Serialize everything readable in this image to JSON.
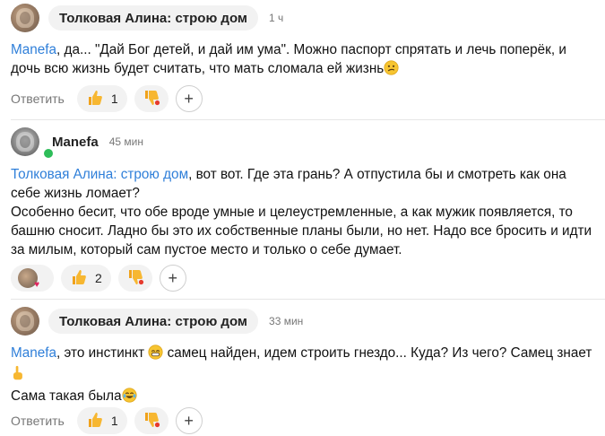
{
  "comments": [
    {
      "author": "Толковая Алина: строю дом",
      "time": "1 ч",
      "mention": "Manefa",
      "body": ", да... \"Дай Бог детей, и дай им ума\". Можно паспорт спрятать и лечь поперёк, и дочь всю жизнь будет считать, что мать сломала ей жизнь",
      "reply_label": "Ответить",
      "like_count": "1",
      "avatar_icon": "user-photo-avatar",
      "body_emoji": "confused-face-emoji"
    },
    {
      "author": "Manefa",
      "time": "45 мин",
      "mention": "Толковая Алина: строю дом",
      "body": ", вот вот. Где эта грань? А отпустила бы и смотреть как она себе жизнь ломает?\nОсобенно бесит, что обе вроде умные и целеустремленные, а как мужик появляется, то башню сносит. Ладно бы это их собственные планы были, но нет. Надо все бросить и идти за милым, который сам пустое место и только о себе думает.",
      "reply_label": "Ответить",
      "like_count": "2",
      "avatar_icon": "user-photo-avatar",
      "status": "online",
      "reaction_icon": "reaction-heart-avatar"
    },
    {
      "author": "Толковая Алина: строю дом",
      "time": "33 мин",
      "mention": "Manefa",
      "body_part1": ", это инстинкт",
      "body_part2": " самец найден, идем строить гнездо... Куда? Из чего? Самец знает",
      "body_line2": "Сама такая была",
      "reply_label": "Ответить",
      "like_count": "1",
      "avatar_icon": "user-photo-avatar",
      "emojis": [
        "grinning-face-emoji",
        "pointing-hand-emoji",
        "tears-of-joy-emoji"
      ]
    }
  ],
  "icons": {
    "like": "thumbs-up-icon",
    "dislike": "thumbs-down-icon",
    "add": "plus-icon"
  },
  "colors": {
    "mention": "#2f7fd9",
    "chip_bg": "#f2f2f2",
    "online": "#2ebd59",
    "muted": "#777777"
  }
}
